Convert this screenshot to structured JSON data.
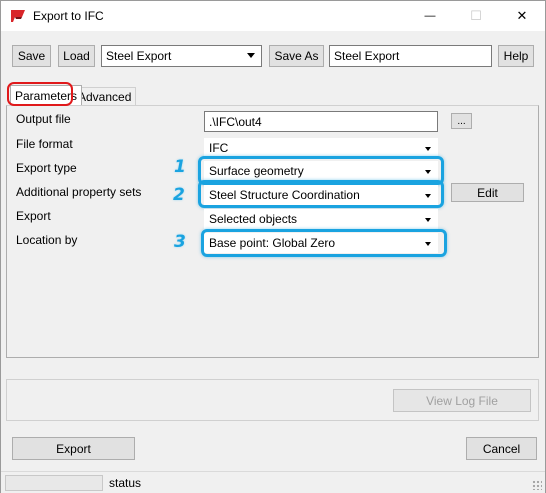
{
  "window": {
    "title": "Export to IFC",
    "minimize_glyph": "—",
    "maximize_glyph": "☐",
    "close_glyph": "✕"
  },
  "toolbar": {
    "save_label": "Save",
    "load_label": "Load",
    "preset_value": "Steel Export",
    "save_as_label": "Save As",
    "save_as_name": "Steel Export",
    "help_label": "Help"
  },
  "tabs": [
    {
      "label": "Parameters",
      "active": true
    },
    {
      "label": "Advanced",
      "active": false
    }
  ],
  "parameters": {
    "output_file": {
      "label": "Output file",
      "value": ".\\IFC\\out4",
      "browse_label": "..."
    },
    "file_format": {
      "label": "File format",
      "value": "IFC"
    },
    "export_type": {
      "label": "Export type",
      "value": "Surface geometry",
      "callout": "1"
    },
    "property_sets": {
      "label": "Additional property sets",
      "value": "Steel Structure Coordination",
      "callout": "2",
      "edit_label": "Edit"
    },
    "export": {
      "label": "Export",
      "value": "Selected objects"
    },
    "location_by": {
      "label": "Location by",
      "value": "Base point: Global Zero",
      "callout": "3"
    }
  },
  "log": {
    "view_log_label": "View Log File",
    "enabled": false
  },
  "actions": {
    "export_label": "Export",
    "cancel_label": "Cancel"
  },
  "status": {
    "text": "status"
  },
  "colors": {
    "callout_highlight": "#1aa3e0",
    "tab_highlight": "#e0191b",
    "window_background": "#f0f0f0"
  }
}
